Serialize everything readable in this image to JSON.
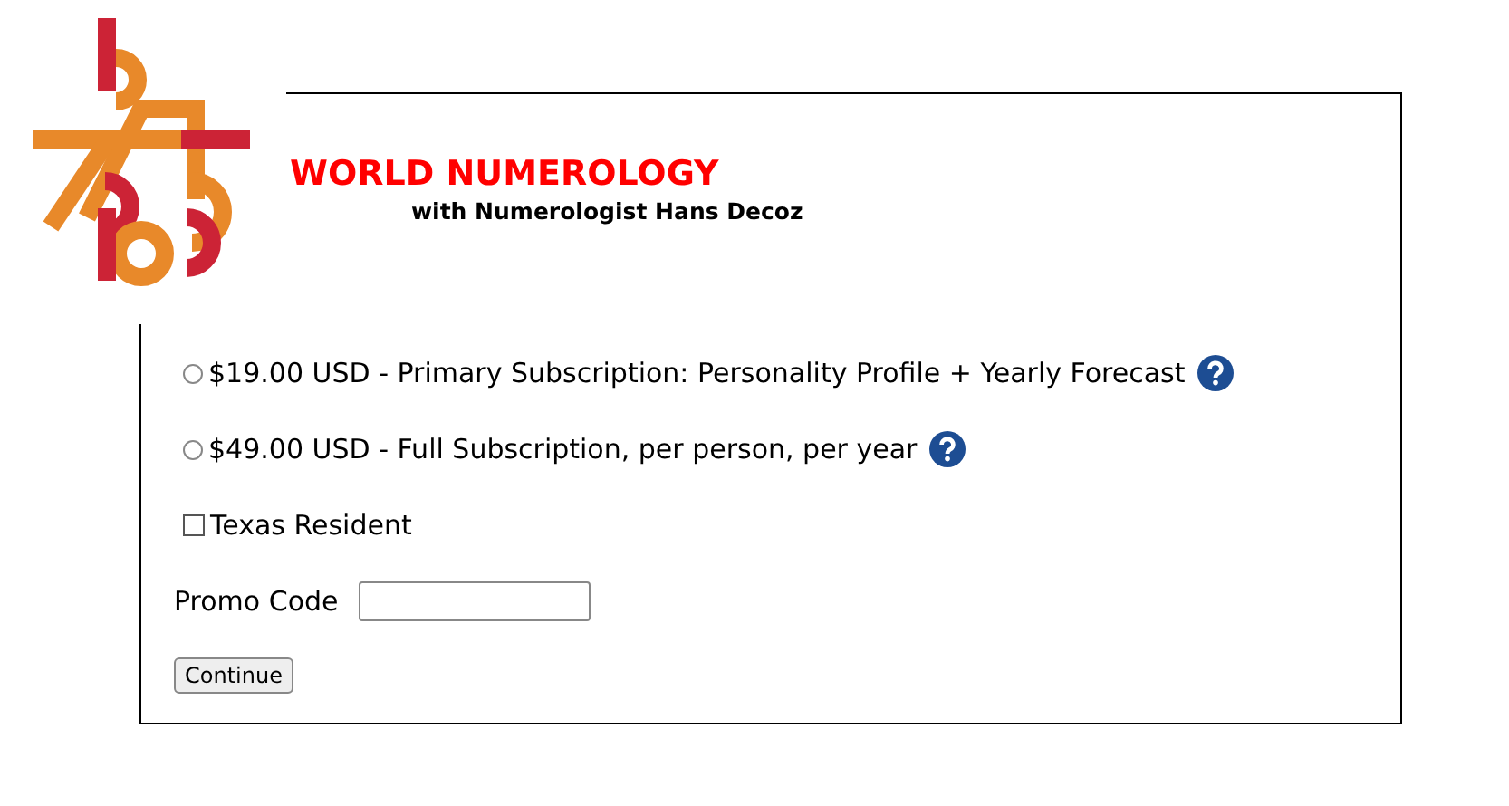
{
  "header": {
    "title": "WORLD NUMEROLOGY",
    "subtitle": "with Numerologist Hans Decoz"
  },
  "options": [
    {
      "label": "$19.00 USD - Primary Subscription: Personality Profile + Yearly Forecast",
      "selected": false
    },
    {
      "label": "$49.00 USD - Full Subscription, per person, per year",
      "selected": false
    }
  ],
  "resident": {
    "label": "Texas Resident",
    "checked": false
  },
  "promo": {
    "label": "Promo Code"
  },
  "button": "Continue"
}
